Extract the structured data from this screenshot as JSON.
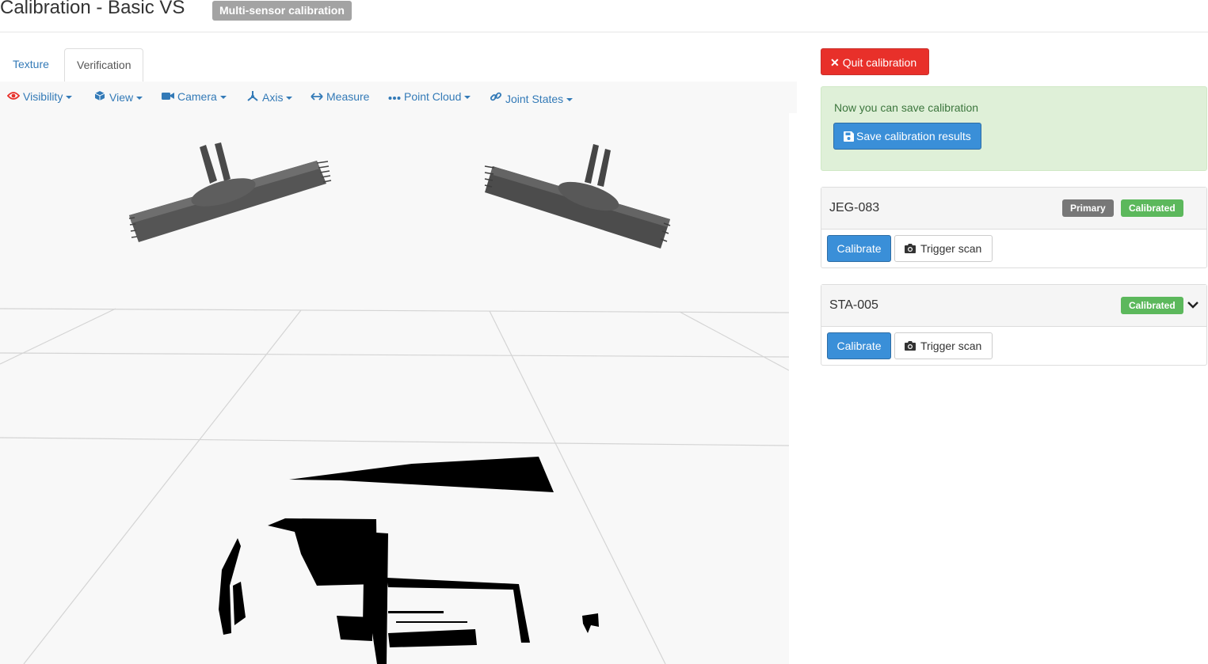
{
  "header": {
    "title": "Calibration - Basic VS",
    "badge": "Multi-sensor calibration"
  },
  "tabs": [
    {
      "label": "Texture",
      "active": false
    },
    {
      "label": "Verification",
      "active": true
    }
  ],
  "viewer_toolbar": [
    {
      "label": "Visibility",
      "icon": "eye-icon",
      "dropdown": true
    },
    {
      "label": "View",
      "icon": "cube-icon",
      "dropdown": true
    },
    {
      "label": "Camera",
      "icon": "video-camera-icon",
      "dropdown": true
    },
    {
      "label": "Axis",
      "icon": "axis-icon",
      "dropdown": true
    },
    {
      "label": "Measure",
      "icon": "arrows-horizontal-icon",
      "dropdown": false
    },
    {
      "label": "Point Cloud",
      "icon": "ellipsis-icon",
      "dropdown": true
    },
    {
      "label": "Joint States",
      "icon": "link-icon",
      "dropdown": true
    }
  ],
  "sidebar": {
    "quit_label": "Quit calibration",
    "alert": {
      "message": "Now you can save calibration",
      "save_label": "Save calibration results"
    },
    "sensors": [
      {
        "name": "JEG-083",
        "primary_label": "Primary",
        "status": "Calibrated",
        "calibrate_label": "Calibrate",
        "trigger_label": "Trigger scan"
      },
      {
        "name": "STA-005",
        "status": "Calibrated",
        "calibrate_label": "Calibrate",
        "trigger_label": "Trigger scan",
        "collapse_icon": "chevron-down-icon"
      }
    ]
  },
  "colors": {
    "link": "#337ab7",
    "danger": "#e8302a",
    "primary_button": "#3a8fd8",
    "success_label": "#5cb85c",
    "primary_label": "#777777",
    "alert_bg": "#dff0d8",
    "alert_text": "#3c763d"
  }
}
